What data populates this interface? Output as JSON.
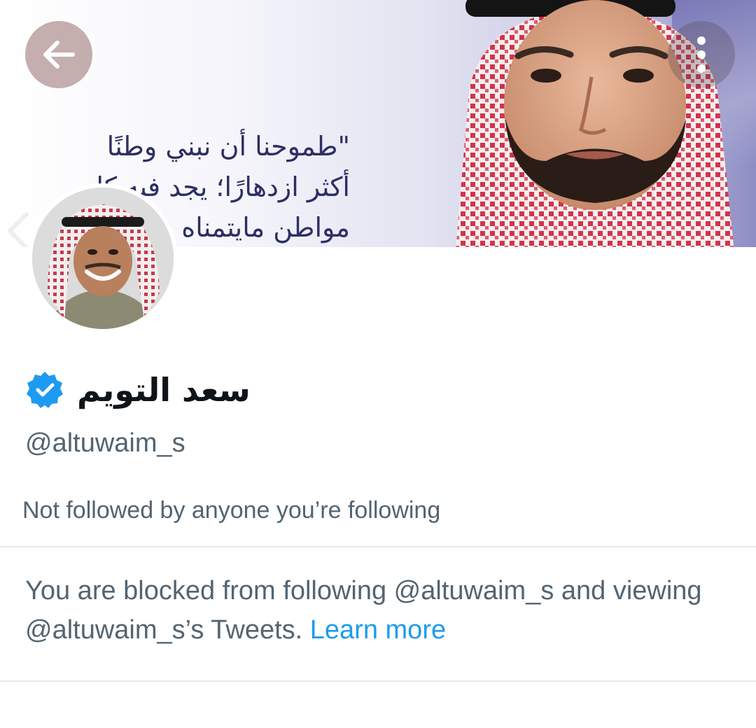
{
  "banner": {
    "quote_lines": [
      "\"طموحنا أن نبني وطنًا",
      "أكثر ازدهارًا؛ يجد فيه كل",
      "مواطن مايتمناه"
    ]
  },
  "header": {
    "back_icon": "arrow-left-icon",
    "more_icon": "more-vertical-icon"
  },
  "profile": {
    "display_name": "سعد التويم",
    "verified_icon": "verified-badge-icon",
    "handle": "@altuwaim_s",
    "followed_by": "Not followed by anyone you’re following"
  },
  "blocked_notice": {
    "text": "You are blocked from following @altuwaim_s and viewing @altuwaim_s’s Tweets. ",
    "link_label": "Learn more"
  },
  "colors": {
    "accent": "#1d9bf0",
    "secondary_text": "#536471",
    "primary_text": "#0f1419",
    "divider": "#e6e9eb"
  }
}
